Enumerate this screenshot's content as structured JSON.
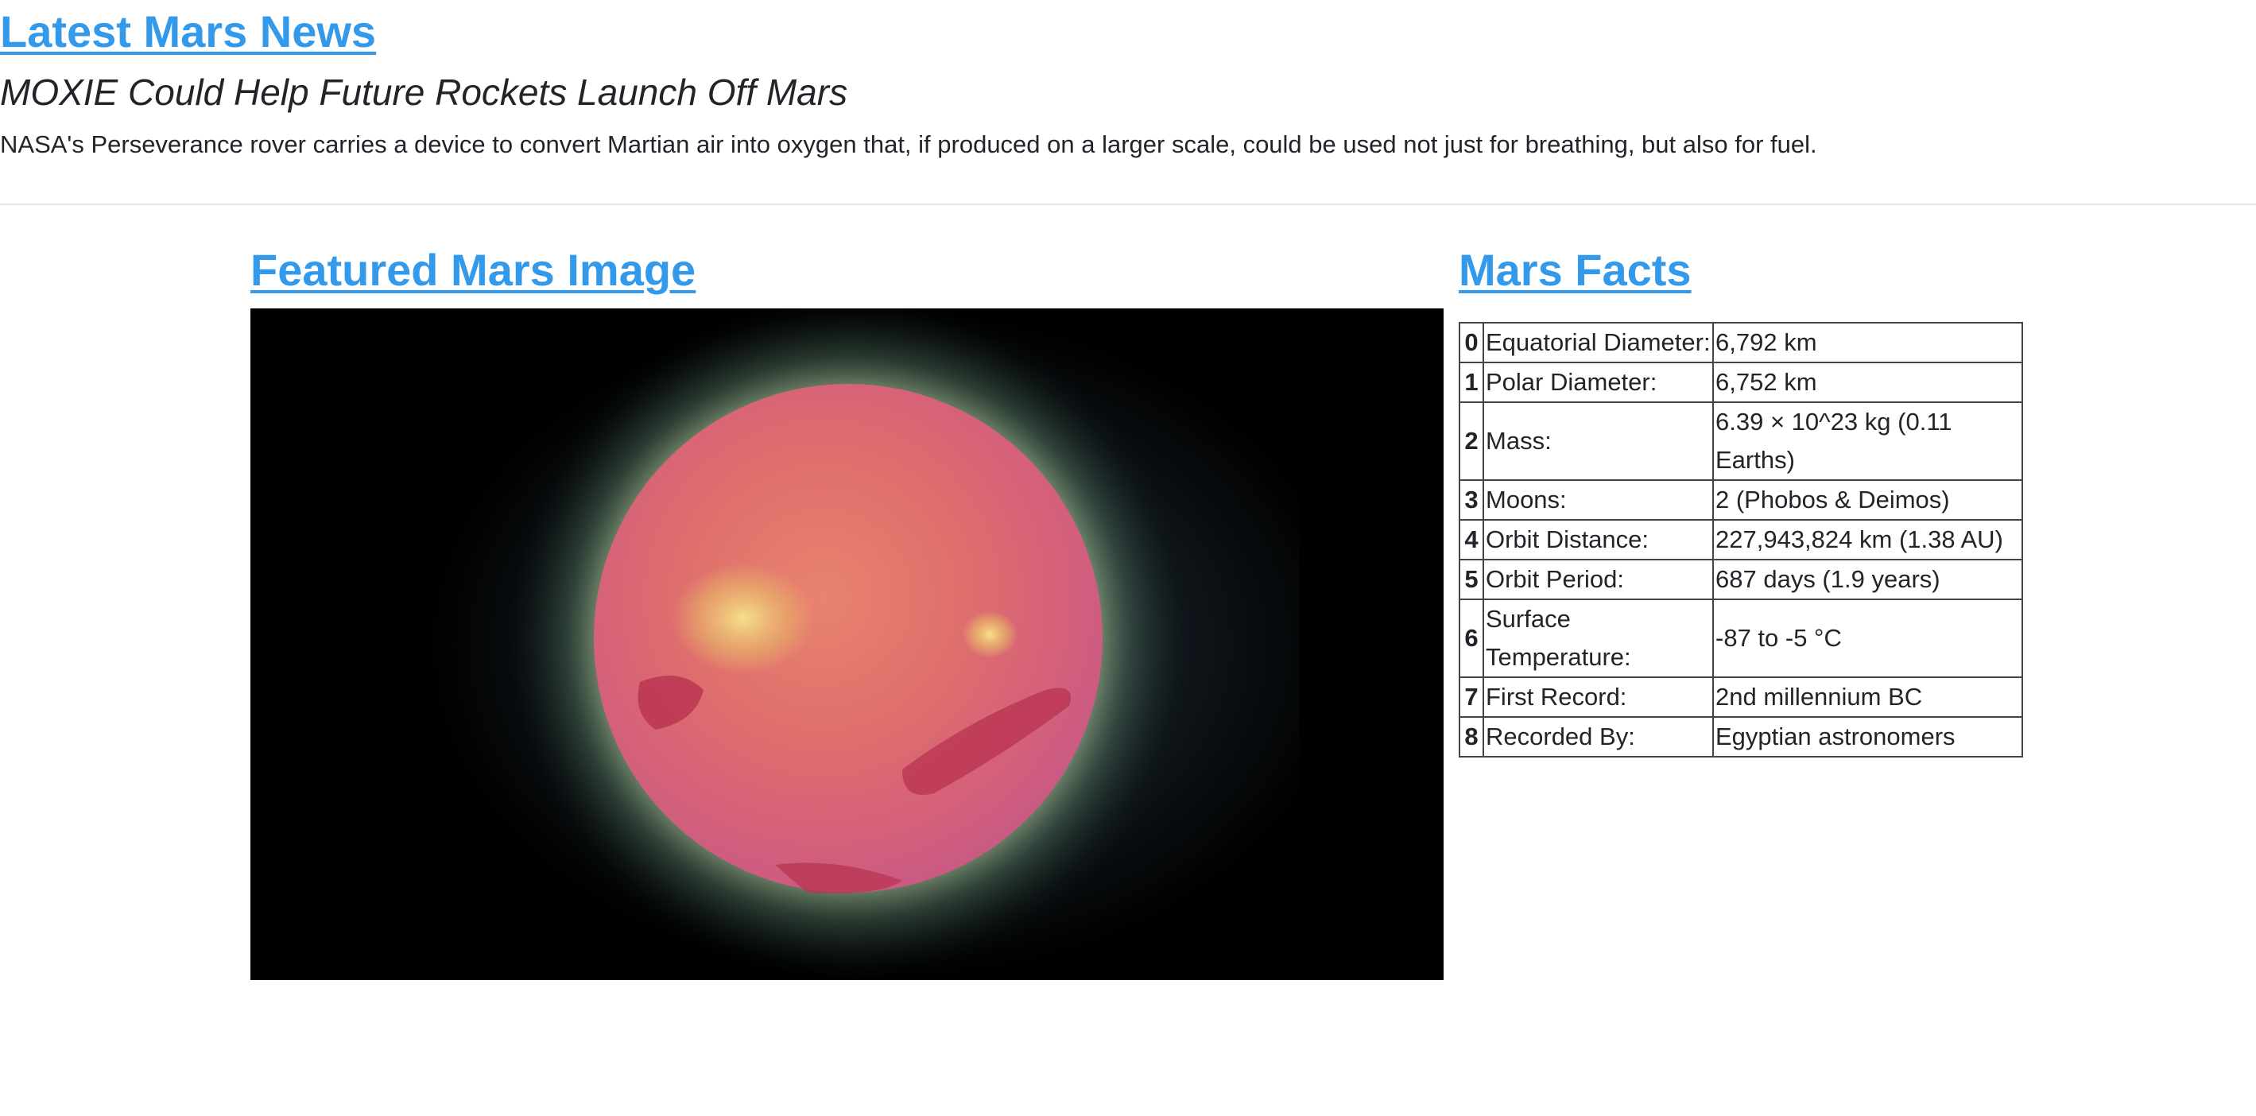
{
  "news": {
    "heading": "Latest Mars News",
    "title": "MOXIE Could Help Future Rockets Launch Off Mars",
    "teaser": "NASA's Perseverance rover carries a device to convert Martian air into oxygen that, if produced on a larger scale, could be used not just for breathing, but also for fuel."
  },
  "featured_image": {
    "heading": "Featured Mars Image"
  },
  "facts": {
    "heading": "Mars Facts",
    "rows": [
      {
        "index": "0",
        "label": "Equatorial Diameter:",
        "value": "6,792 km"
      },
      {
        "index": "1",
        "label": "Polar Diameter:",
        "value": "6,752 km"
      },
      {
        "index": "2",
        "label": "Mass:",
        "value": "6.39 × 10^23 kg (0.11 Earths)"
      },
      {
        "index": "3",
        "label": "Moons:",
        "value": "2 (Phobos & Deimos)"
      },
      {
        "index": "4",
        "label": "Orbit Distance:",
        "value": "227,943,824 km (1.38 AU)"
      },
      {
        "index": "5",
        "label": "Orbit Period:",
        "value": "687 days (1.9 years)"
      },
      {
        "index": "6",
        "label": "Surface Temperature:",
        "value": "-87 to -5 °C"
      },
      {
        "index": "7",
        "label": "First Record:",
        "value": "2nd millennium BC"
      },
      {
        "index": "8",
        "label": "Recorded By:",
        "value": "Egyptian astronomers"
      }
    ]
  },
  "colors": {
    "link": "#3399ea",
    "text": "#212529",
    "divider": "#e3e5e7"
  }
}
